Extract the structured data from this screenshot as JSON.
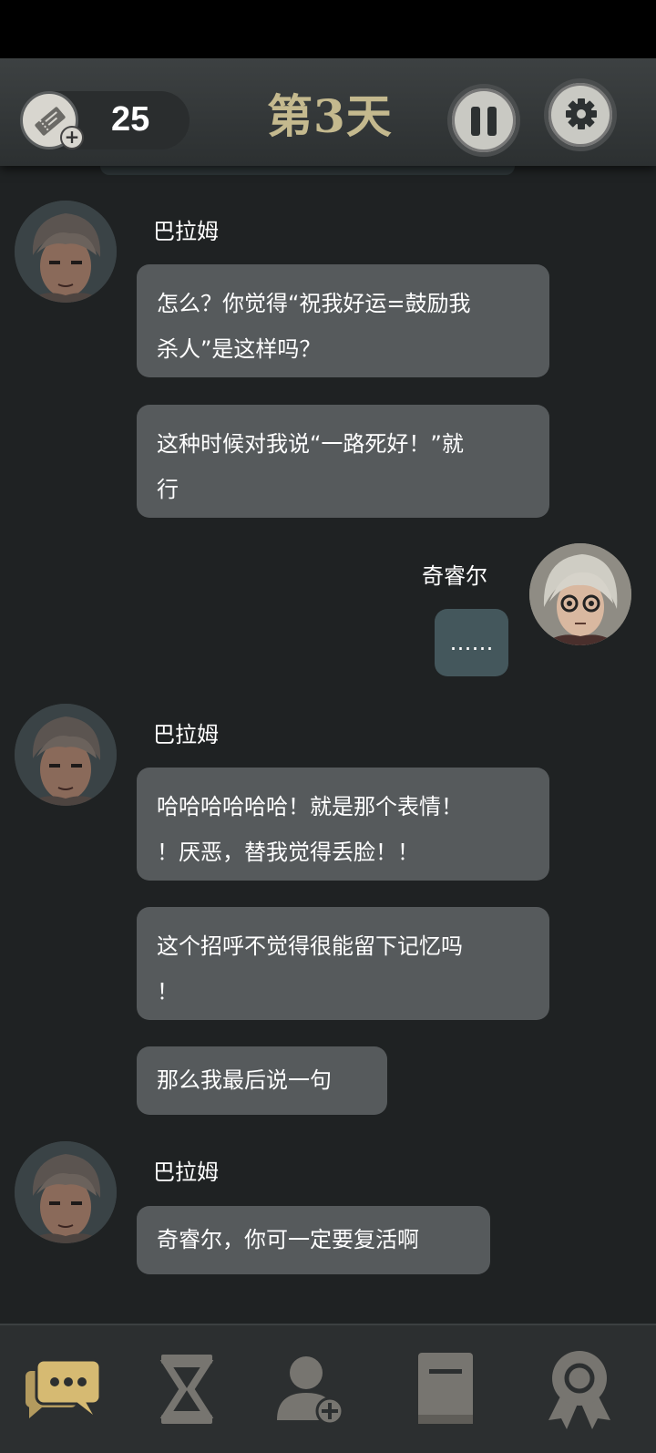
{
  "header": {
    "ticket_count": "25",
    "day_title": "第3天",
    "pause_icon": "pause-icon",
    "settings_icon": "gear-icon"
  },
  "messages": [
    {
      "speaker": "巴拉姆",
      "side": "left",
      "text": "怎么？你觉得“祝我好运=鼓励我杀人”是这样吗？"
    },
    {
      "speaker": "巴拉姆",
      "side": "left",
      "text": "这种时候对我说“一路死好！”就行"
    },
    {
      "speaker": "奇睿尔",
      "side": "right",
      "text": "……"
    },
    {
      "speaker": "巴拉姆",
      "side": "left",
      "text": "哈哈哈哈哈哈！就是那个表情！！厌恶，替我觉得丢脸！！"
    },
    {
      "speaker": "巴拉姆",
      "side": "left",
      "text": "这个招呼不觉得很能留下记忆吗！"
    },
    {
      "speaker": "巴拉姆",
      "side": "left",
      "text": "那么我最后说一句"
    },
    {
      "speaker": "巴拉姆",
      "side": "left",
      "text": "奇睿尔，你可一定要复活啊"
    }
  ],
  "names": {
    "left1": "巴拉姆",
    "right1": "奇睿尔",
    "left2": "巴拉姆",
    "left3": "巴拉姆"
  },
  "bubbles": {
    "b1_line1": "怎么？你觉得“祝我好运=鼓励我",
    "b1_line2": "杀人”是这样吗？",
    "b2_line1": "这种时候对我说“一路死好！”就",
    "b2_line2": "行",
    "b3": "……",
    "b4_line1": "哈哈哈哈哈哈！就是那个表情！",
    "b4_line2": "！厌恶，替我觉得丢脸！！",
    "b5_line1": "这个招呼不觉得很能留下记忆吗",
    "b5_line2": "！",
    "b6": "那么我最后说一句",
    "b7": "奇睿尔，你可一定要复活啊"
  },
  "nav": [
    {
      "icon": "chat-icon",
      "active": true
    },
    {
      "icon": "hourglass-icon",
      "active": false
    },
    {
      "icon": "add-person-icon",
      "active": false
    },
    {
      "icon": "book-icon",
      "active": false
    },
    {
      "icon": "award-icon",
      "active": false
    }
  ],
  "colors": {
    "background": "#1f2223",
    "bubble_left": "#565a5c",
    "bubble_right": "#44575c",
    "title_gold": "#c4b98e",
    "nav_active": "#d6ba72",
    "nav_inactive": "#777570"
  }
}
